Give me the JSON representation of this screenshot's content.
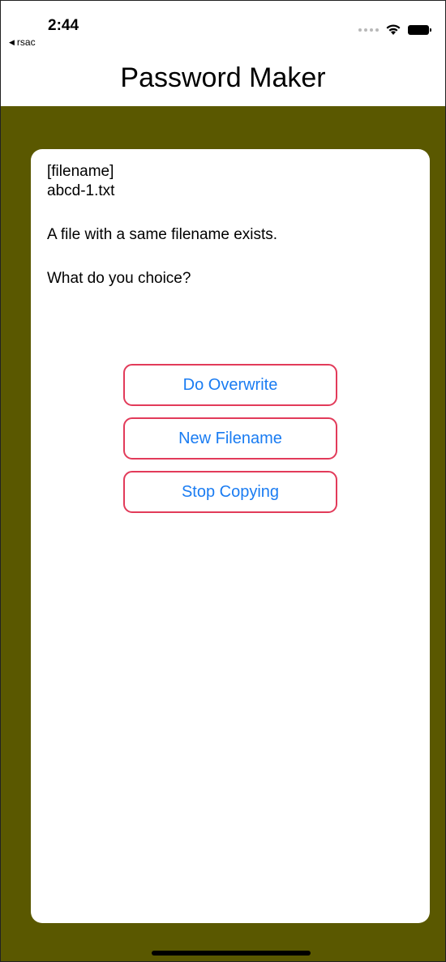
{
  "status_bar": {
    "time": "2:44",
    "back_app": "rsac",
    "icons": [
      "signal-dots-icon",
      "wifi-icon",
      "battery-icon"
    ]
  },
  "nav": {
    "title": "Password Maker"
  },
  "dialog": {
    "label": "[filename]",
    "filename": "abcd-1.txt",
    "message": "A file with a same filename exists.",
    "question": "What do you choice?"
  },
  "buttons": {
    "overwrite": "Do Overwrite",
    "new_filename": "New Filename",
    "stop_copying": "Stop Copying"
  },
  "colors": {
    "background_olive": "#5a5800",
    "button_border": "#e23b5a",
    "button_text": "#1a7cf2"
  }
}
